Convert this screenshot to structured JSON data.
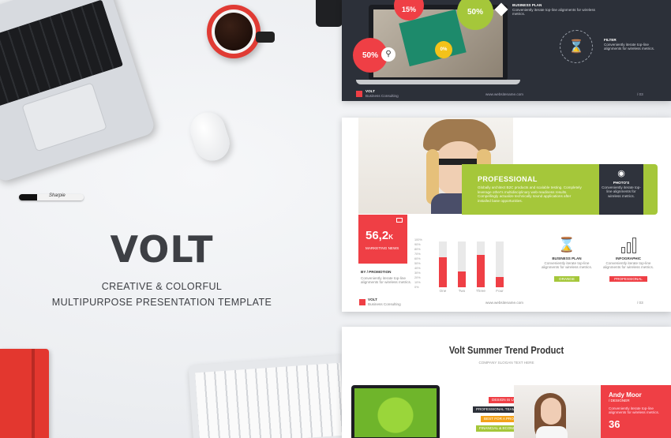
{
  "hero": {
    "title": "VOLT",
    "subtitle_line1": "CREATIVE & COLORFUL",
    "subtitle_line2": "MULTIPURPOSE PRESENTATION TEMPLATE"
  },
  "colors": {
    "red": "#ef3f45",
    "green": "#a5c73a",
    "dark": "#2b2f38",
    "text": "#3d3f44"
  },
  "slide1": {
    "bubble_top": "15%",
    "bubble_top_right": "50%",
    "bubble_left": "50%",
    "bubble_small": "0%",
    "business_plan_title": "BUSINESS PLAN",
    "business_plan_text": "Conveniently iterate top-line alignments for wireless metrics.",
    "filter_title": "FILTER",
    "filter_text": "Conveniently iterate top-line alignments for wireless metrics.",
    "brand": "VOLT",
    "brand_sub": "Business Consulting",
    "url": "www.websitename.com",
    "page": "/ 03"
  },
  "slide2": {
    "professional_label": "PROFESSIONAL",
    "professional_text": "Globally architect B2C products and scalable testing. Completely leverage other's multidisciplinary web-readiness results. Compellingly actualize technically sound applications after installed base opportunities.",
    "photos_title": "PHOTO'S",
    "photos_text": "Conveniently iterate top-line alignments for wireless metrics.",
    "stat_value": "56,2",
    "stat_suffix": "K",
    "stat_label": "MARKETING NEWS",
    "promo_label": "BY / PROMOTION",
    "promo_text": "Conveniently iterate top-line alignments for wireless metrics.",
    "business_plan_title": "BUSINESS PLAN",
    "business_plan_text": "Conveniently iterate top-line alignments for wireless metrics.",
    "business_plan_badge": "ORANGE",
    "infographic_title": "INFOGRAPHIC",
    "infographic_text": "Conveniently iterate top-line alignments for wireless metrics.",
    "infographic_badge": "PROFESSIONAL",
    "brand": "VOLT",
    "brand_sub": "Business Consulting",
    "url": "www.websitename.com",
    "page": "/ 03"
  },
  "chart_data": {
    "type": "bar",
    "categories": [
      "One",
      "Two",
      "Three",
      "Four"
    ],
    "values": [
      65,
      35,
      70,
      22
    ],
    "ylim": [
      0,
      100
    ],
    "yticks": [
      "100%",
      "90%",
      "80%",
      "70%",
      "60%",
      "50%",
      "40%",
      "30%",
      "20%",
      "10%",
      "0%"
    ],
    "grid": false
  },
  "slide3": {
    "title": "Volt Summer Trend Product",
    "subtitle": "COMPANY SLOGAN TEXT HERE",
    "tag1": "DESIGN IS UNIQUE",
    "tag2": "PROFESSIONAL TEAM SOLUTIONS",
    "tag3": "BEST FOR A PRODUCT",
    "tag4": "FINANCIAL & ECONOMY",
    "person_name": "Andy Moor",
    "person_role": "/ DESIGNER",
    "person_text": "Conveniently iterate top-line alignments for wireless metrics.",
    "person_stat": "36"
  },
  "marker_text": "Sharpie"
}
